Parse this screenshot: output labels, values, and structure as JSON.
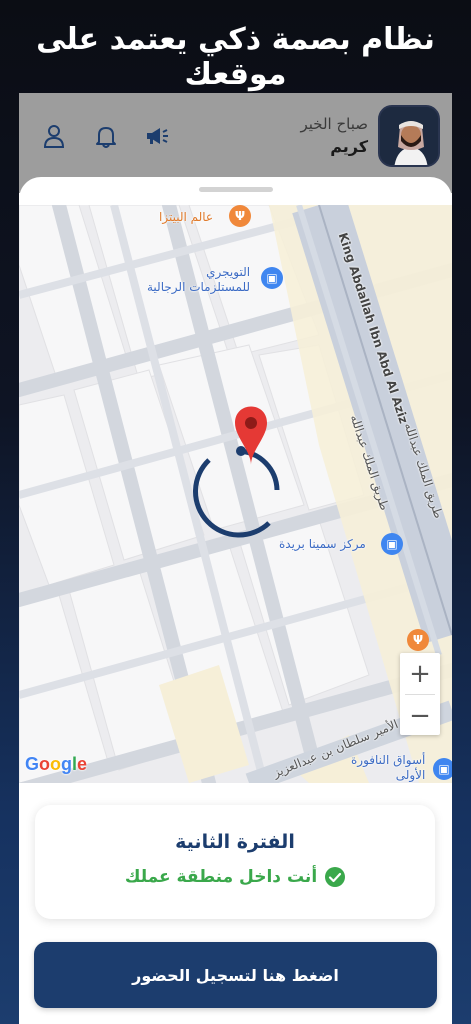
{
  "promo": {
    "title": "نظام بصمة ذكي يعتمد على موقعك"
  },
  "header": {
    "greeting": "صباح الخير",
    "user_name": "كريم",
    "icons": [
      "user-icon",
      "bell-icon",
      "megaphone-icon"
    ]
  },
  "map": {
    "pois": [
      {
        "name": "عالم البيتزا",
        "kind": "restaurant"
      },
      {
        "name": "التويجري\nللمستلزمات الرجالية",
        "kind": "shop"
      },
      {
        "name": "مركز سمينا بريدة",
        "kind": "shop"
      },
      {
        "name": "أسواق النافورة\nالأولى",
        "kind": "shop"
      }
    ],
    "roads": {
      "king_abdallah_en": "King Abdallah Ibn Abd Al Aziz",
      "king_abdallah_ar": "طريق الملك عبدالله",
      "king_abdallah_ar2": "طريق الملك عبدالله",
      "prince_sultan": "الأمير سلطان بن عبدالعزيز"
    },
    "attribution": "Google",
    "zoom_in_label": "+",
    "zoom_out_label": "−",
    "colors": {
      "pin": "#e53935",
      "ring": "#1c3d6e",
      "poi_blue": "#3f86f0",
      "poi_orange": "#f0883a"
    }
  },
  "status": {
    "period": "الفترة الثانية",
    "zone": "أنت داخل منطقة عملك",
    "zone_color": "#3aa84b"
  },
  "actions": {
    "checkin_label": "اضغط هنا لتسجيل الحضور",
    "checkin_color": "#1c3d6e"
  }
}
